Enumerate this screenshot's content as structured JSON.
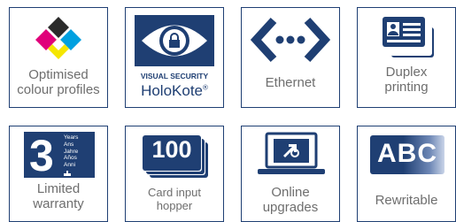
{
  "colors": {
    "navy": "#1f3f73",
    "label_gray": "#6e6e6e"
  },
  "tiles": [
    {
      "icon": "cmyk-color-diamonds-icon",
      "label_line1": "Optimised",
      "label_line2": "colour profiles"
    },
    {
      "icon": "eye-lock-icon",
      "badge_line1": "VISUAL SECURITY",
      "badge_line2": "HoloKote",
      "badge_mark": "®"
    },
    {
      "icon": "ethernet-icon",
      "label_line1": "Ethernet"
    },
    {
      "icon": "duplex-id-card-icon",
      "label_line1": "Duplex",
      "label_line2": "printing"
    },
    {
      "icon": "three-year-warranty-icon",
      "badge_number": "3",
      "badge_words": [
        "Years",
        "Ans",
        "Jahre",
        "Años",
        "Anni"
      ],
      "label_line1": "Limited",
      "label_line2": "warranty"
    },
    {
      "icon": "card-stack-icon",
      "badge_number": "100",
      "label_line1": "Card input",
      "label_line2": "hopper"
    },
    {
      "icon": "laptop-upgrade-icon",
      "label_line1": "Online",
      "label_line2": "upgrades"
    },
    {
      "icon": "abc-rewritable-card-icon",
      "badge_text": "ABC",
      "label_line1": "Rewritable"
    }
  ]
}
